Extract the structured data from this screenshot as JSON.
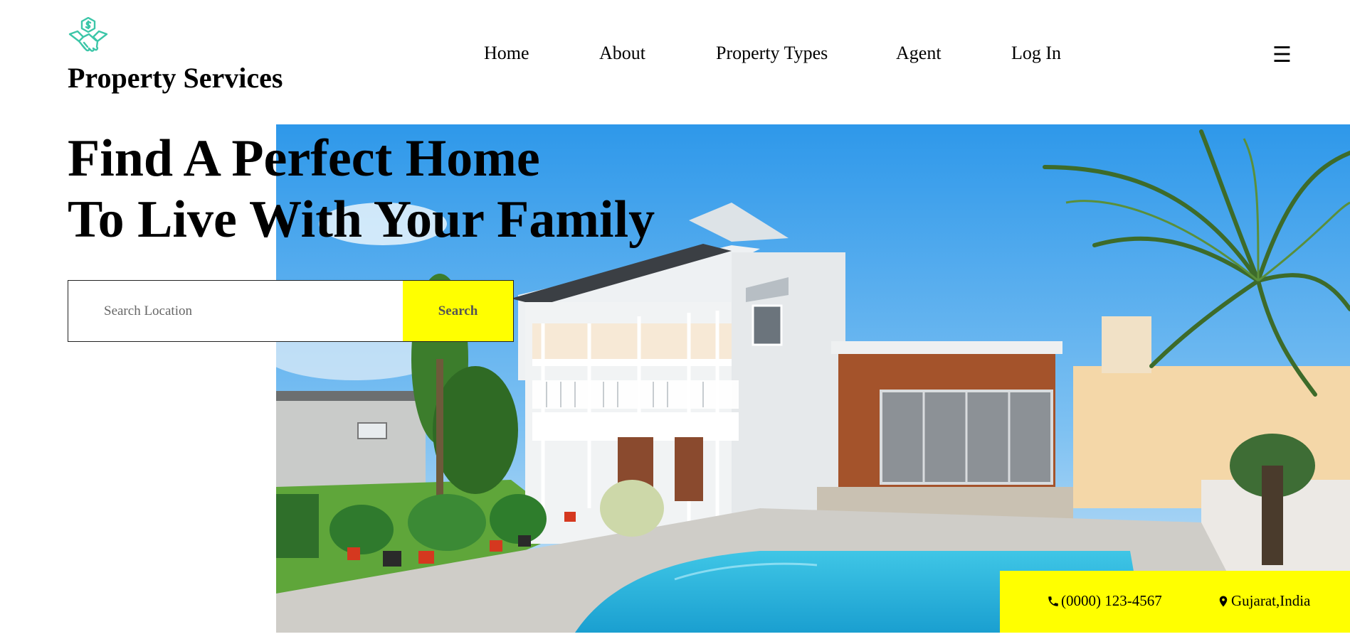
{
  "header": {
    "brand": "Property Services",
    "logo_icon": "handshake-dollar-icon",
    "menu_icon": "hamburger-menu-icon",
    "nav": [
      {
        "label": "Home"
      },
      {
        "label": "About"
      },
      {
        "label": "Property Types"
      },
      {
        "label": "Agent"
      },
      {
        "label": "Log In"
      }
    ]
  },
  "hero": {
    "headline_line1": "Find A Perfect Home",
    "headline_line2": "To Live With Your Family",
    "image": "house-with-pool-photo"
  },
  "search": {
    "placeholder": "Search Location",
    "button_label": "Search"
  },
  "contact": {
    "phone": "(0000) 123-4567",
    "phone_icon": "phone-icon",
    "location": "Gujarat,India",
    "location_icon": "map-marker-icon"
  },
  "colors": {
    "accent": "#ffff00",
    "logo": "#3cc6a8",
    "text": "#000000"
  }
}
